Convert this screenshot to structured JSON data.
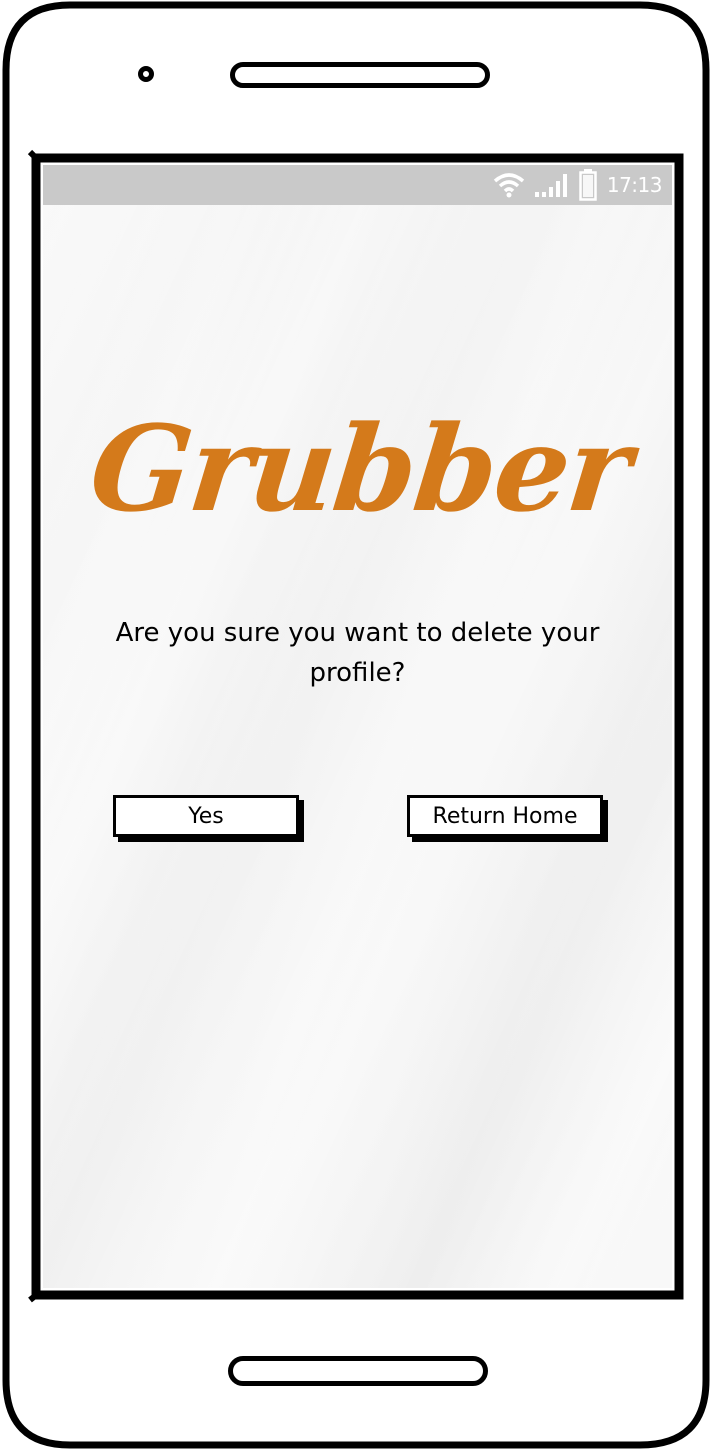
{
  "status_bar": {
    "time": "17:13",
    "icons": [
      "wifi-icon",
      "signal-icon",
      "battery-icon"
    ],
    "background": "#c9c9c9"
  },
  "logo": {
    "text": "Grubber",
    "color": "#d47a1b"
  },
  "dialog": {
    "prompt": "Are you sure you want to delete your profile?",
    "yes_label": "Yes",
    "return_label": "Return Home"
  }
}
